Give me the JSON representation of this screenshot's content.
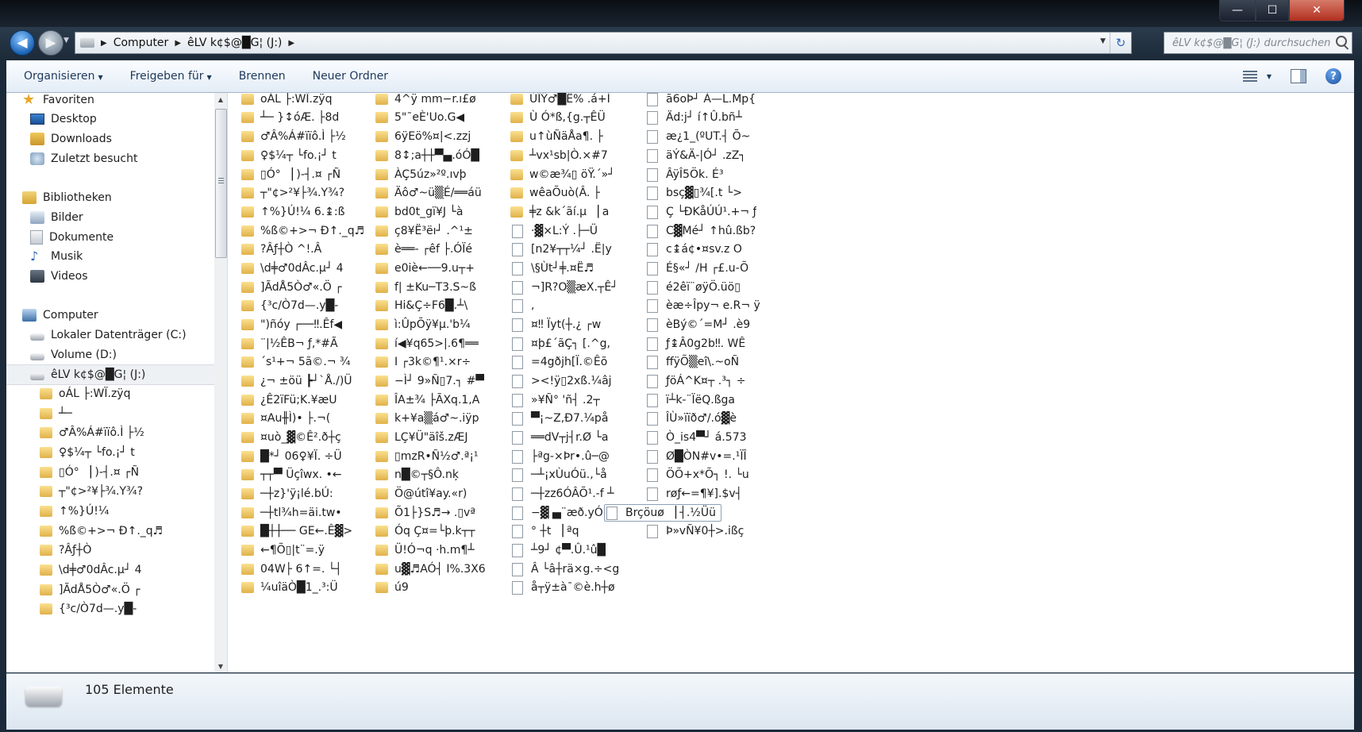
{
  "window": {
    "minimize": "—",
    "maximize": "☐",
    "close": "✕"
  },
  "address": {
    "crumbs": [
      "Computer",
      "êLV k¢$@█G¦ (J:)"
    ],
    "refresh": "↻"
  },
  "search": {
    "placeholder": "êLV k¢$@█G¦ (J:) durchsuchen"
  },
  "toolbar": {
    "organize": "Organisieren",
    "share": "Freigeben für",
    "burn": "Brennen",
    "new_folder": "Neuer Ordner",
    "help": "?"
  },
  "nav": {
    "favorites_header": "Favoriten",
    "favorites": [
      "Desktop",
      "Downloads",
      "Zuletzt besucht"
    ],
    "libraries_header": "Bibliotheken",
    "libraries": [
      "Bilder",
      "Dokumente",
      "Musik",
      "Videos"
    ],
    "computer_header": "Computer",
    "drives": [
      "Lokaler Datenträger (C:)",
      "Volume (D:)",
      "êLV k¢$@█G¦ (J:)"
    ],
    "drive_folders": [
      "oÁL ├:WÏ.zÿq",
      "┴─",
      "♂Â%Á#ïïô.Ì ├½",
      "♀$¼┬ └fo.¡┘ t",
      "▯Ó° ▕ )-┤.¤ ┌Ñ",
      "┬\"¢>²¥├¾.Y¾?",
      "↑%}Ú!¼",
      "%ß©+>¬ Ð↑._q♬",
      "?Âƒ┼Ò",
      "\\d╪♂0dÂc.µ┘ 4",
      "]ÃdÅ5Ò♂«.Ö ┌",
      "{³c/Ò7d—.y█-"
    ]
  },
  "files": {
    "col1": [
      "oÁL ├:WÏ.zÿq",
      "┴─ }↕óÆ. ├8d",
      "♂Â%Á#ïïô.Ì ├½",
      "♀$¼┬ └fo.¡┘ t",
      "▯Ó° ▕ )-┤.¤ ┌Ñ",
      "┬\"¢>²¥├¾.Y¾?",
      "↑%}Ú!¼ 6.↨:ß",
      "%ß©+>¬ Ð↑._q♬",
      "?Âƒ┼Ò ^!.Â",
      "\\d╪♂0dÂc.µ┘ 4",
      "]ÃdÅ5Ò♂«.Ö ┌",
      "{³c/Ò7d—.y█-",
      "\")ñóy ┌──‼.Êf◀",
      "¨|½ÊB¬ ƒ,*#Ã",
      "´s¹+¬ 5ã©.¬ ¾",
      "¿¬ ±öü ┣┘`Å./)Ü",
      "¿Ê2ïFü;K.¥æU",
      "¤Au╫Ì)• ├.¬(",
      "¤uò_▓©Ê².ð┼ç",
      "█*┘ 06♀¥Ï. ÷Ü",
      "┬┬▀ Üçîwx. •←",
      "─┼z}'ÿ¡lé.bÚ:",
      "─┼tl¾h=äi.tw•",
      "█┼┼── GE←.Ê▓>",
      "←¶Õ▯|t¨=.ÿ",
      "04W├ 6↑=. └┤",
      "¼uîäÒ█1_.³:Ü"
    ],
    "col2": [
      "4^ÿ mm−r.ı£ø",
      "5\"¯eÈ'Uo.G◀",
      "6ÿEö%¤|<.zzj",
      "8↕;a┼┼▀▄.óÓ█",
      "ÀÇ5úz»²º.ıvþ",
      "Äô♂~ü▒É/══áü",
      "bd0t_gï¥J └à",
      "ç8¥Ë³ëı┘ .^¹±",
      "è══- ┌êf ├.ÓÏé",
      "e0iè←──9.u┬+",
      "f| ±Ku─T3.S~ß",
      "Hi&Ç÷F6█.┴\\",
      "ì:ÛpÕÿ¥µ.'b¼",
      "í◀¥q65>|.6¶══",
      "I ┌3k©¶¹.×r÷",
      "−Ì┘ 9»Ñ▯7.┐ #▀",
      "ÎA±¾ ├ÃXq.1,A",
      "k+¥a▒á♂~.iÿp",
      "LÇ¥Ü\"äîš.zÆJ",
      "▯mzR•Ñ½♂.ª¡¹",
      "n█©┬§Ô.nķ",
      "Ö@útî¥ay.«r)",
      "Õ1├}S♬→ .▯vª",
      "Óq Ç¤=└þ.k┬┬",
      "Ü!Ó¬q ·h.m¶┴",
      "u▓♬AÓ┤ I%.3X6",
      "ú9"
    ],
    "col3": [
      "ÙÏŸ♂█Ê% .á+Ì",
      "Ù Ó*ß,{g.┬ÊÜ",
      "u↑ùÑäÅa¶.  ├",
      "┴vx¹sb|Ò.×#7",
      "w©æ¾▯ öŸ.´»┘",
      "wêaÕuò(Â. ├",
      "╪z &k´ãí.µ ▕ a",
      "·▓×L:Ý .├─Ü",
      "[n2¥┬┬¼┘ .Ë|y",
      "\\§Ùt┘╪.¤Ë♬",
      "¬]R?O▒æX.┬Ê┘",
      ",",
      "¤‼ Ïyt(┼.¿ ┌w",
      "¤þ£´ãÇ┐ [.^g,",
      "=4gðjh[Ï.©Êõ",
      "><!ÿ▯2xß.¼âj",
      "»¥Ñ° 'ñ┤ .2┬",
      "▀¡~Z,Ð7.¼på",
      "══dV┬j┤r.Ø └a",
      "├ªg-×Þr•.û─@",
      "─┴¡xÙuÓü.,└å",
      "─┼zz6ÓÂÕ¹.-f ┴",
      "−▓ ▄¨æð.yÓU",
      "° ┼t ▕ ªq",
      "┴9┘ ¢▀.Û.¹û█",
      "Â └â┼rä×g.÷<g",
      "å┬ÿ±à¯©è.h┼ø"
    ],
    "col4": [
      "ã6oÞ┘ À—L.Mp{",
      "Äd:j┘ í↑Û.bñ┴",
      "æ¿1_(ºUT.┤ Õ~",
      "äÝ&Ä-|Ó┘ .zZ┐",
      "ÂÿÎ5Ök. É³",
      "bsç▓▯¾[.t └>",
      "Ç └ÐKåÚÚ¹.+¬ ƒ",
      "C▓Mé┘ ↑hû.ßb?",
      "c↨á¢•¤sv.z O",
      "É§«┘ /H ┌£.u-Õ",
      "é2êï¨øÿÖ.üö▯",
      "èæ÷Îpy¬ e.R¬ ÿ",
      "èBý©´=M┘ .è9",
      "ƒ↨Â0g2b‼.   WÊ",
      "ffÿÕ▒eî\\.~oÑ",
      "ƒöÁ^K¤┬ .³┐ ÷",
      "ï┴k-¨ÏëQ.ßga",
      "ÎÙ»ïïð♂/.ó▓è",
      "Ò_is4▀┘ á.573",
      "Ø█ÒN#v•=.¹ÏÎ",
      "ÖÕ+x*Õ┐ !. └u",
      "røƒ←=¶¥].$v┤",
      "Brçöuø ▕ ┤.½Üü",
      "Þ»vÑ¥0┼>.ißç"
    ]
  },
  "status": {
    "count": "105 Elemente"
  }
}
